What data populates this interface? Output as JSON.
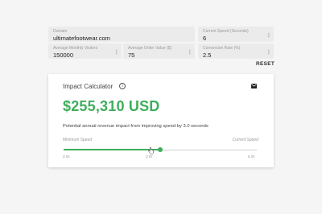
{
  "inputs": {
    "domain": {
      "label": "Domain",
      "value": "ultimatefootwear.com"
    },
    "current_speed": {
      "label": "Current Speed (Seconds)",
      "value": "6"
    },
    "monthly_visitors": {
      "label": "Average Monthly Visitors",
      "value": "150000"
    },
    "order_value": {
      "label": "Average Order Value ($)",
      "value": "75"
    },
    "conversion_rate": {
      "label": "Conversion Rate (%)",
      "value": "2.5"
    }
  },
  "reset_label": "RESET",
  "card": {
    "title": "Impact Calculator",
    "info_glyph": "i",
    "info_icon": "info-icon",
    "email_icon": "email-icon",
    "impact_value": "$255,310 USD",
    "description": "Potential annual revenue impact from improving speed by 3.0 seconds",
    "slider": {
      "min_label": "Minimum Speed",
      "current_label": "Current Speed",
      "ticks": [
        "0.0s",
        "3.0s",
        "6.0s"
      ],
      "value_fraction": 0.5
    }
  },
  "colors": {
    "accent": "#3fae5c",
    "background": "#f5f5f5",
    "field": "#ebebeb"
  }
}
